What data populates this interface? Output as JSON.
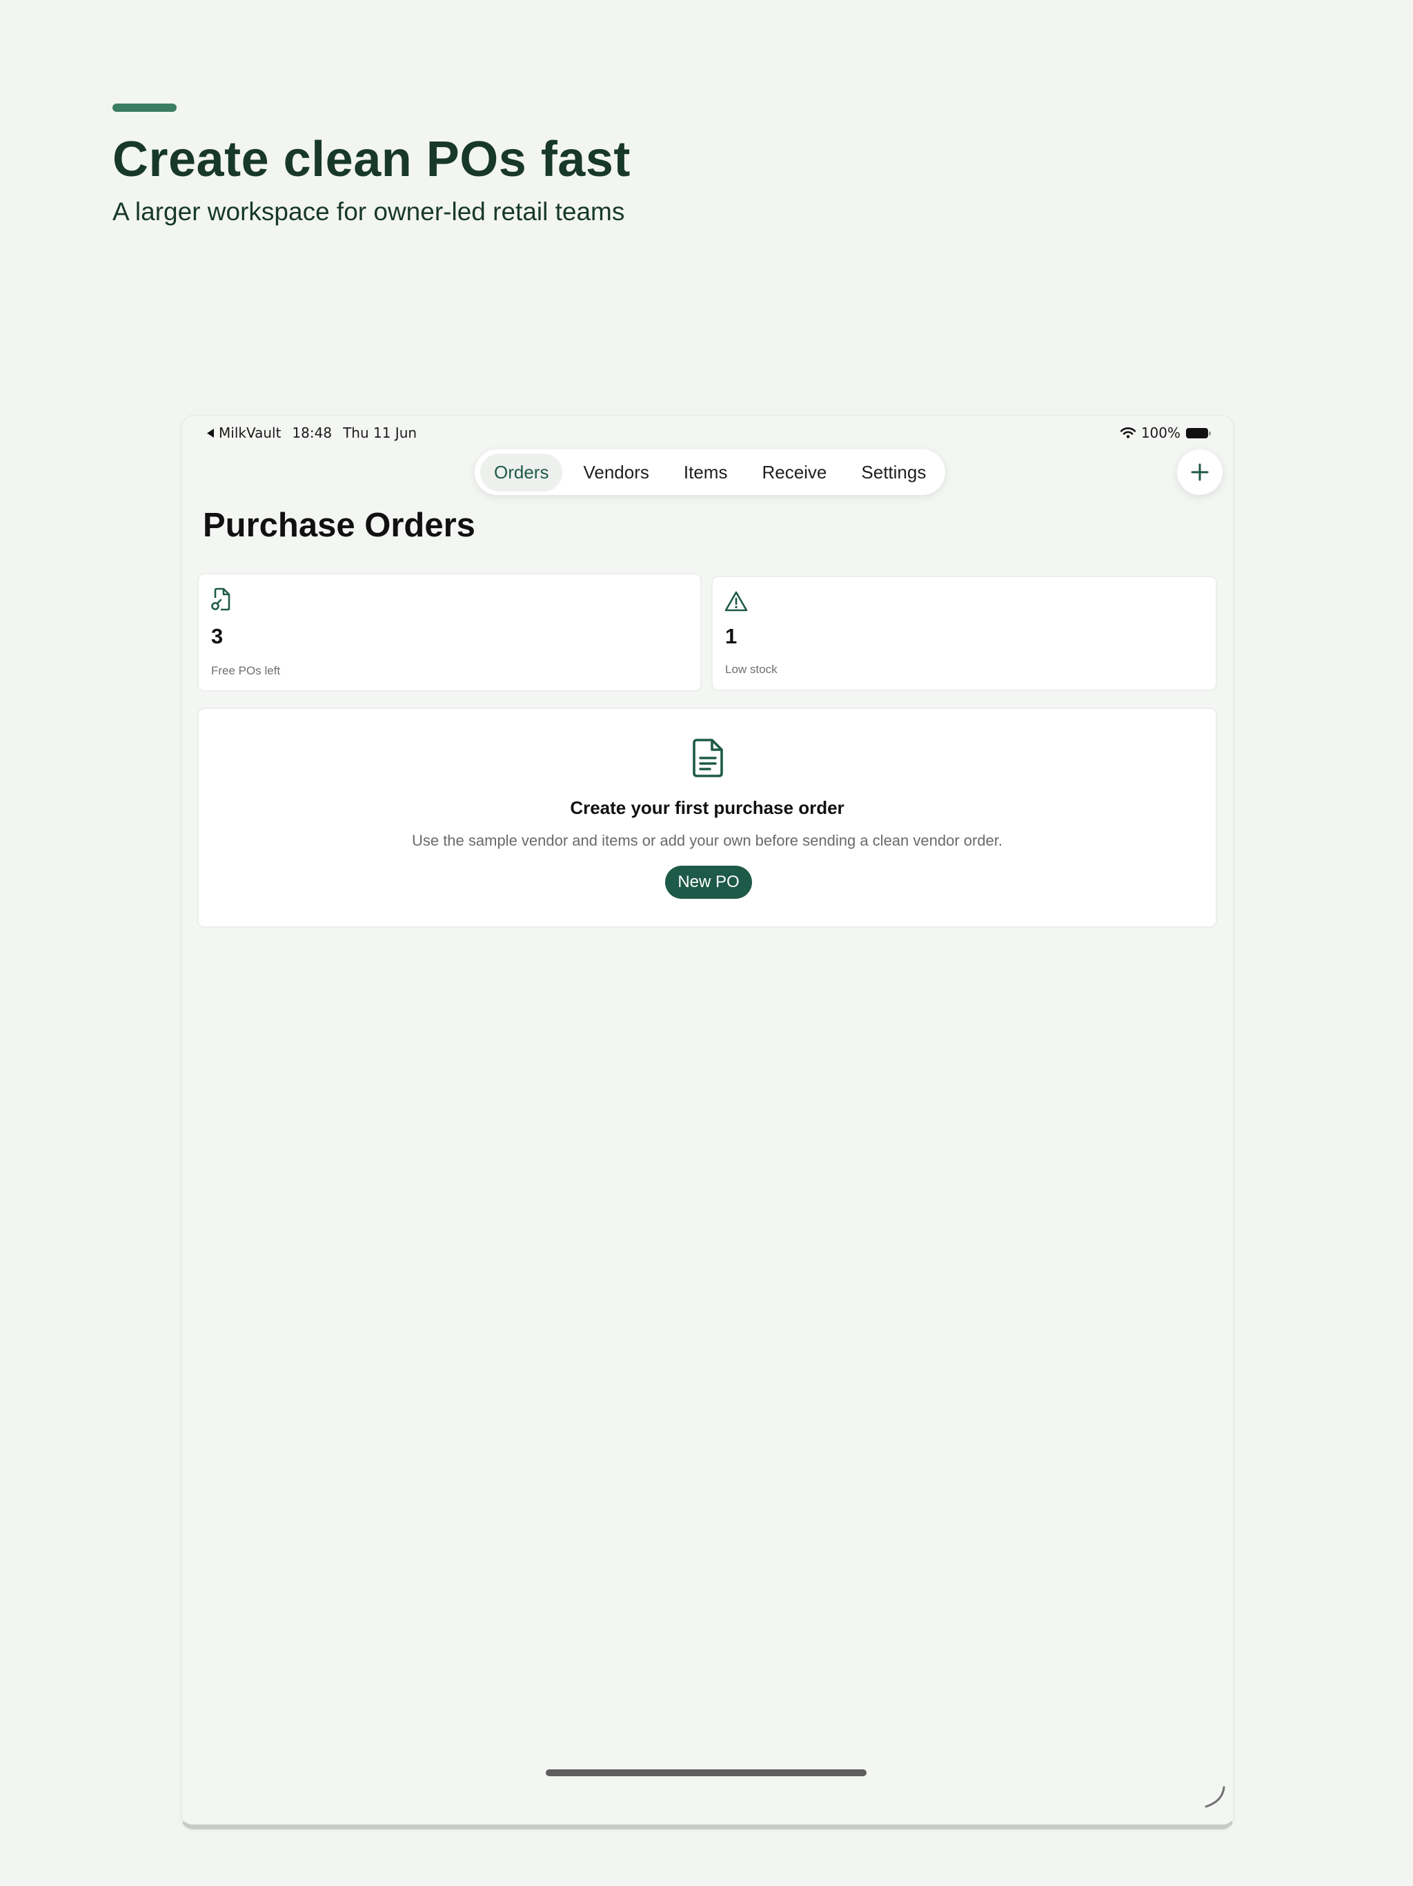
{
  "hero": {
    "title": "Create clean POs fast",
    "subtitle": "A larger workspace for owner-led retail teams"
  },
  "status_bar": {
    "back_app": "MilkVault",
    "time": "18:48",
    "date": "Thu 11 Jun",
    "battery": "100%"
  },
  "tabs": [
    {
      "label": "Orders",
      "active": true
    },
    {
      "label": "Vendors",
      "active": false
    },
    {
      "label": "Items",
      "active": false
    },
    {
      "label": "Receive",
      "active": false
    },
    {
      "label": "Settings",
      "active": false
    }
  ],
  "page": {
    "title": "Purchase Orders"
  },
  "stats": [
    {
      "value": "3",
      "label": "Free POs left",
      "icon": "document-key-icon"
    },
    {
      "value": "1",
      "label": "Low stock",
      "icon": "warning-triangle-icon"
    }
  ],
  "empty_state": {
    "icon": "document-icon",
    "title": "Create your first purchase order",
    "description": "Use the sample vendor and items or add your own before sending a clean vendor order.",
    "button_label": "New PO"
  },
  "colors": {
    "accent": "#3a7d65",
    "brand_dark": "#1e5a48",
    "heading": "#17382b",
    "background": "#f3f5f2"
  }
}
